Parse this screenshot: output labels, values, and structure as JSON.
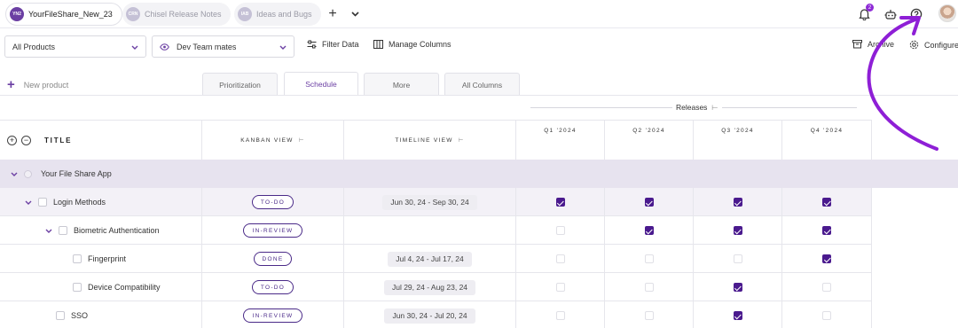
{
  "workspace_tabs": [
    {
      "initials": "YN2",
      "label": "YourFileShare_New_23",
      "active": true
    },
    {
      "initials": "CRN",
      "label": "Chisel Release Notes",
      "active": false
    },
    {
      "initials": "IAB",
      "label": "Ideas and Bugs",
      "active": false
    }
  ],
  "topbar": {
    "add_label": "+",
    "notification_count": "2"
  },
  "filterbar": {
    "products_value": "All Products",
    "teammates_value": "Dev Team mates",
    "filter_label": "Filter Data",
    "manage_columns_label": "Manage Columns",
    "archive_label": "Archive",
    "configure_label": "Configure"
  },
  "new_product_label": "New product",
  "view_tabs": [
    "Prioritization",
    "Schedule",
    "More",
    "All Columns"
  ],
  "active_view_tab": "Schedule",
  "releases_label": "Releases",
  "columns": {
    "title": "TITLE",
    "kanban": "KANBAN VIEW",
    "timeline": "TIMELINE VIEW",
    "quarters": [
      "Q1 '2024",
      "Q2 '2024",
      "Q3 '2024",
      "Q4 '2024"
    ]
  },
  "group": {
    "label": "Your File Share App"
  },
  "rows": [
    {
      "title": "Login Methods",
      "status": "TO-DO",
      "timeline": "Jun 30, 24 - Sep 30, 24",
      "q": [
        true,
        true,
        true,
        true
      ]
    },
    {
      "title": "Biometric Authentication",
      "status": "IN-REVIEW",
      "timeline": "",
      "q": [
        false,
        true,
        true,
        true
      ]
    },
    {
      "title": "Fingerprint",
      "status": "DONE",
      "timeline": "Jul 4, 24 - Jul 17, 24",
      "q": [
        false,
        false,
        false,
        true
      ]
    },
    {
      "title": "Device Compatibility",
      "status": "TO-DO",
      "timeline": "Jul 29, 24 - Aug 23, 24",
      "q": [
        false,
        false,
        true,
        false
      ]
    },
    {
      "title": "SSO",
      "status": "IN-REVIEW",
      "timeline": "Jun 30, 24 - Jul 20, 24",
      "q": [
        false,
        false,
        true,
        false
      ]
    }
  ],
  "colors": {
    "accent": "#6b3fa3",
    "checkbox_on": "#4a1a8e",
    "group_bg": "#e7e3ef",
    "annotation_arrow": "#8e1fd6"
  }
}
